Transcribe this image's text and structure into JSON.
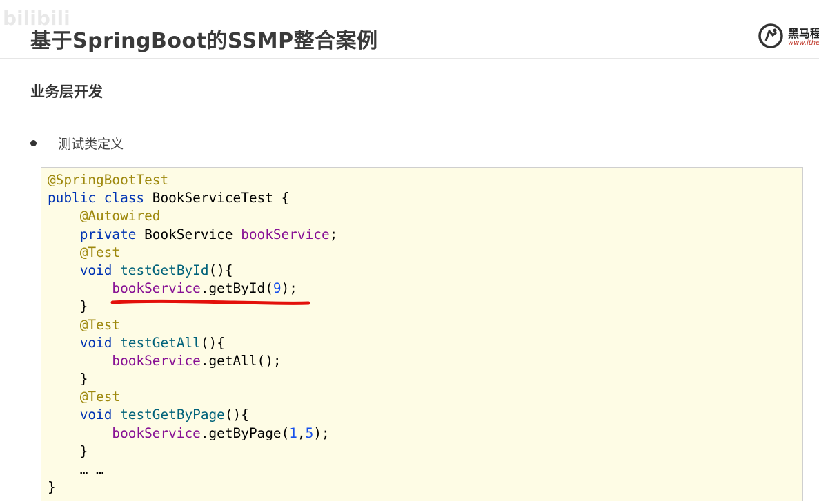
{
  "header": {
    "title": "基于SpringBoot的SSMP整合案例",
    "watermark": "bilibili",
    "logo_text": "黑马程",
    "logo_url": "www.ithei"
  },
  "section": {
    "title": "业务层开发",
    "bullet": "测试类定义"
  },
  "code": {
    "l1_annotation": "@SpringBootTest",
    "l2_kw1": "public",
    "l2_kw2": "class",
    "l2_rest": " BookServiceTest {",
    "l3_annotation": "@Autowired",
    "l4_kw": "private",
    "l4_type": " BookService ",
    "l4_field": "bookService",
    "l4_end": ";",
    "l5_annotation": "@Test",
    "l6_kw": "void",
    "l6_method": "testGetById",
    "l6_end": "(){",
    "l7_field": "bookService",
    "l7_call": ".getById(",
    "l7_arg": "9",
    "l7_end": ");",
    "l8_close": "}",
    "l9_annotation": "@Test",
    "l10_kw": "void",
    "l10_method": "testGetAll",
    "l10_end": "(){",
    "l11_field": "bookService",
    "l11_call": ".getAll();",
    "l12_close": "}",
    "l13_annotation": "@Test",
    "l14_kw": "void",
    "l14_method": "testGetByPage",
    "l14_end": "(){",
    "l15_field": "bookService",
    "l15_call": ".getByPage(",
    "l15_arg1": "1",
    "l15_comma": ",",
    "l15_arg2": "5",
    "l15_end": ");",
    "l16_close": "}",
    "l17_ellipsis": "… …",
    "l18_close": "}"
  },
  "colors": {
    "keyword": "#0033b3",
    "annotation": "#9e880d",
    "field": "#871094",
    "method": "#00627a",
    "number": "#1750eb",
    "code_bg": "#fefce5",
    "underline": "#e3100a"
  }
}
